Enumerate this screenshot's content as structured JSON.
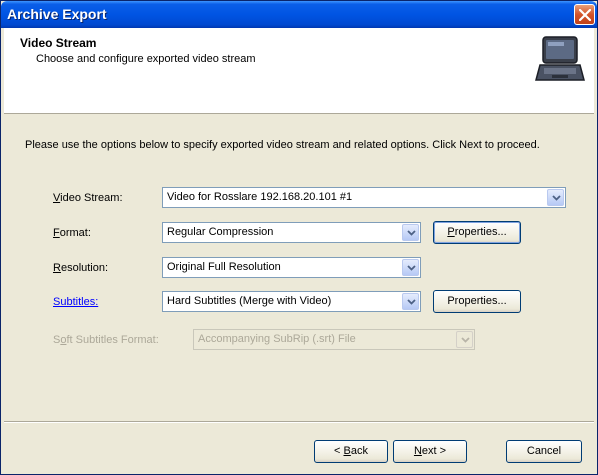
{
  "window": {
    "title": "Archive Export"
  },
  "header": {
    "title": "Video Stream",
    "subtitle": "Choose and configure exported video stream",
    "icon": "laptop-icon"
  },
  "intro_text": "Please use the options below to specify exported video stream and related options. Click Next to proceed.",
  "fields": {
    "video_stream": {
      "label_prefix": "",
      "label_key": "V",
      "label_rest": "ideo Stream:",
      "value": "Video for Rosslare 192.168.20.101 #1"
    },
    "format": {
      "label_key": "F",
      "label_rest": "ormat:",
      "value": "Regular Compression",
      "properties_key": "P",
      "properties_rest": "roperties..."
    },
    "resolution": {
      "label_key": "R",
      "label_rest": "esolution:",
      "value": "Original Full Resolution"
    },
    "subtitles": {
      "label": "Subtitles:",
      "value": "Hard Subtitles (Merge with Video)",
      "properties_label": "Properties..."
    },
    "soft_subtitles_format": {
      "label_pre": "S",
      "label_key": "o",
      "label_rest": "ft Subtitles Format:",
      "value": "Accompanying SubRip (.srt) File"
    }
  },
  "footer": {
    "back_pre": "< ",
    "back_key": "B",
    "back_rest": "ack",
    "next_key": "N",
    "next_rest": "ext >",
    "cancel": "Cancel"
  }
}
